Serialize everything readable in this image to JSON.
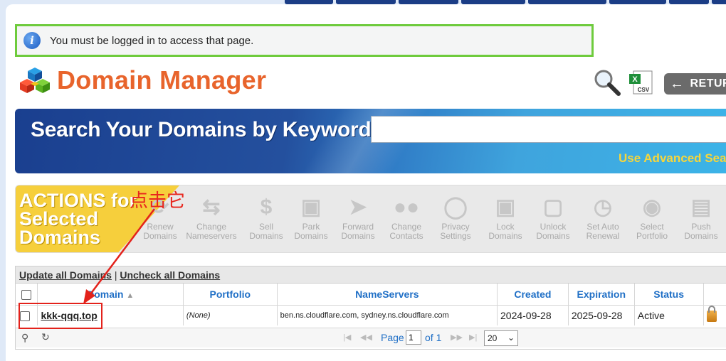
{
  "alert": {
    "message": "You must be logged in to access that page."
  },
  "header": {
    "title": "Domain Manager",
    "return_label": "RETUR"
  },
  "banner": {
    "title": "Search Your Domains by Keyword",
    "advanced_link": "Use Advanced Sea"
  },
  "actions": {
    "heading": "ACTIONS for\nSelected\nDomains",
    "items": [
      {
        "line1": "Renew",
        "line2": "Domains",
        "icon": "renew-icon"
      },
      {
        "line1": "Change",
        "line2": "Nameservers",
        "icon": "nameservers-icon"
      },
      {
        "line1": "Sell",
        "line2": "Domains",
        "icon": "dollar-icon"
      },
      {
        "line1": "Park",
        "line2": "Domains",
        "icon": "park-icon"
      },
      {
        "line1": "Forward",
        "line2": "Domains",
        "icon": "forward-arrow-icon"
      },
      {
        "line1": "Change",
        "line2": "Contacts",
        "icon": "contacts-icon"
      },
      {
        "line1": "Privacy",
        "line2": "Settings",
        "icon": "privacy-icon"
      },
      {
        "line1": "Lock",
        "line2": "Domains",
        "icon": "lock-icon"
      },
      {
        "line1": "Unlock",
        "line2": "Domains",
        "icon": "unlock-icon"
      },
      {
        "line1": "Set Auto",
        "line2": "Renewal",
        "icon": "clock-icon"
      },
      {
        "line1": "Select",
        "line2": "Portfolio",
        "icon": "portfolio-icon"
      },
      {
        "line1": "Push",
        "line2": "Domains",
        "icon": "push-icon"
      }
    ]
  },
  "annotation": {
    "text": "点击它"
  },
  "grid": {
    "update_all": "Update all Domains",
    "separator": "|",
    "uncheck_all": "Uncheck all Domains",
    "columns": [
      "Domain",
      "Portfolio",
      "NameServers",
      "Created",
      "Expiration",
      "Status"
    ],
    "rows": [
      {
        "domain": "kkk-qqq.top",
        "portfolio": "(None)",
        "nameservers": "ben.ns.cloudflare.com, sydney.ns.cloudflare.com",
        "created": "2024-09-28",
        "expiration": "2025-09-28",
        "status": "Active"
      }
    ],
    "pager": {
      "page_label": "Page",
      "page_value": "1",
      "of_label": "of 1",
      "per_page": "20"
    }
  },
  "colors": {
    "accent": "#e8642c",
    "link": "#1f6fc6",
    "annotation": "#e3221b",
    "alert_border": "#6ecb3c"
  }
}
